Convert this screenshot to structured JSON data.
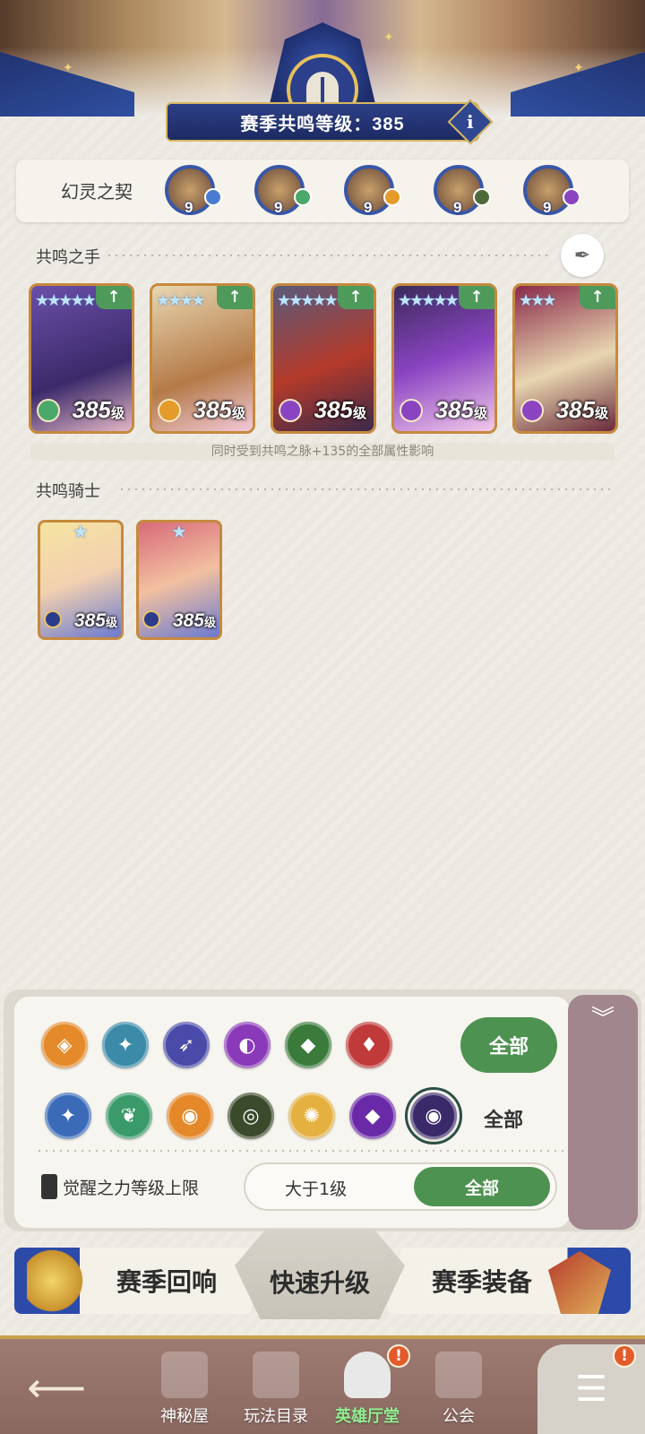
{
  "header": {
    "season_label": "赛季共鸣等级：385",
    "info_icon": "i"
  },
  "contract": {
    "title": "幻灵之契",
    "items": [
      {
        "level": "9",
        "color": "#3857a8",
        "elem": "#4a7bd0"
      },
      {
        "level": "9",
        "color": "#3857a8",
        "elem": "#4aa86a"
      },
      {
        "level": "9",
        "color": "#3857a8",
        "elem": "#e49b2a"
      },
      {
        "level": "9",
        "color": "#3857a8",
        "elem": "#4f6a3a"
      },
      {
        "level": "9",
        "color": "#3857a8",
        "elem": "#8a44c2"
      }
    ]
  },
  "resonance_hand": {
    "title": "共鸣之手",
    "note": "同时受到共鸣之脉+135的全部属性影响",
    "heroes": [
      {
        "stars": "★★★★★",
        "level": "385",
        "unit": "级",
        "up": "↑",
        "bg": "linear-gradient(160deg,#6b4fa8,#3b2a6a 60%,#e4b6c6)",
        "elem": "#4aa86a"
      },
      {
        "stars": "★★★★",
        "level": "385",
        "unit": "级",
        "up": "↑",
        "bg": "linear-gradient(160deg,#e8d6b0,#b47a48 60%,#f2c9d9)",
        "elem": "#e49b2a"
      },
      {
        "stars": "★★★★★",
        "level": "385",
        "unit": "级",
        "up": "↑",
        "bg": "linear-gradient(160deg,#5a5a7a,#b43a2a 55%,#3b2a4a)",
        "elem": "#8a44c2"
      },
      {
        "stars": "★★★★★",
        "level": "385",
        "unit": "级",
        "up": "↑",
        "bg": "linear-gradient(160deg,#3b2a5a,#8a44c2 50%,#f2c9e9)",
        "elem": "#8a44c2"
      },
      {
        "stars": "★★★",
        "level": "385",
        "unit": "级",
        "up": "↑",
        "bg": "linear-gradient(160deg,#8a2a4a,#e8d6b0 55%,#6a2a3a)",
        "elem": "#8a44c2"
      }
    ]
  },
  "resonance_knight": {
    "title": "共鸣骑士",
    "knights": [
      {
        "star": "★",
        "level": "385",
        "unit": "级",
        "bg": "linear-gradient(160deg,#f5e4a0,#f2d0b0 50%,#6a7ad0)"
      },
      {
        "star": "★",
        "level": "385",
        "unit": "级",
        "bg": "linear-gradient(160deg,#d86a7a,#f2c0a0 50%,#6a7ad0)"
      }
    ]
  },
  "filters": {
    "row1": [
      {
        "name": "shield-class-icon",
        "glyph": "◈",
        "color": "#e48a2a"
      },
      {
        "name": "mage-class-icon",
        "glyph": "✦",
        "color": "#3a8aa8"
      },
      {
        "name": "archer-class-icon",
        "glyph": "➶",
        "color": "#4a4aa8"
      },
      {
        "name": "support-class-icon",
        "glyph": "◐",
        "color": "#8a3ab8"
      },
      {
        "name": "assassin-class-icon",
        "glyph": "◆",
        "color": "#3a7a3a"
      },
      {
        "name": "warrior-class-icon",
        "glyph": "♦",
        "color": "#c03a3a"
      }
    ],
    "row2": [
      {
        "name": "water-element-icon",
        "glyph": "✦",
        "color": "#3a6ab8"
      },
      {
        "name": "wind-element-icon",
        "glyph": "❦",
        "color": "#3a9a6a"
      },
      {
        "name": "fire-element-icon",
        "glyph": "◉",
        "color": "#e4882a"
      },
      {
        "name": "earth-element-icon",
        "glyph": "◎",
        "color": "#3a4a2a"
      },
      {
        "name": "light-element-icon",
        "glyph": "✺",
        "color": "#e4b040"
      },
      {
        "name": "dark-element-icon",
        "glyph": "◆",
        "color": "#6a2aa8"
      },
      {
        "name": "void-element-icon",
        "glyph": "◉",
        "color": "#3a2a6a",
        "selected": true
      }
    ],
    "all_pill": "全部",
    "all_text": "全部",
    "awaken_label": "觉醒之力等级上限",
    "level_value": "大于1级",
    "level_all": "全部",
    "collapse_icon": "︾"
  },
  "actions": {
    "season_echo": "赛季回响",
    "quick_upgrade": "快速升级",
    "season_gear": "赛季装备"
  },
  "nav": {
    "back": "⟵",
    "items": [
      {
        "label": "神秘屋"
      },
      {
        "label": "玩法目录"
      },
      {
        "label": "英雄厅堂"
      },
      {
        "label": "公会"
      }
    ],
    "alert": "!",
    "menu": "☰"
  }
}
